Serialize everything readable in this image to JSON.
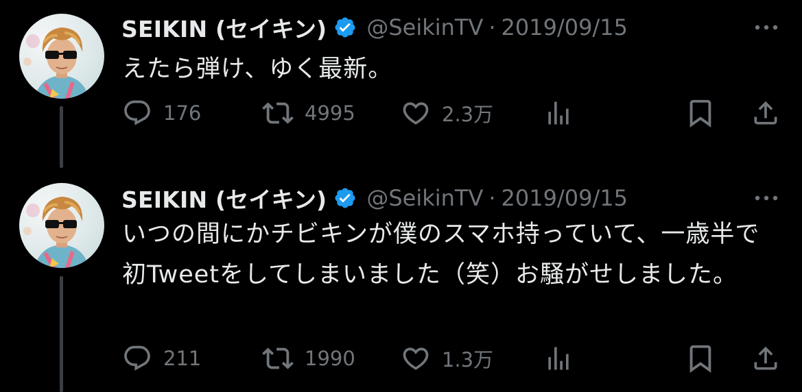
{
  "tweets": [
    {
      "author": {
        "name": "SEIKIN (セイキン)",
        "handle": "@SeikinTV",
        "verified": true
      },
      "separator": "·",
      "date": "2019/09/15",
      "text": "えたら弾け、ゆく最新。",
      "stats": {
        "replies": "176",
        "retweets": "4995",
        "likes": "2.3万"
      }
    },
    {
      "author": {
        "name": "SEIKIN (セイキン)",
        "handle": "@SeikinTV",
        "verified": true
      },
      "separator": "·",
      "date": "2019/09/15",
      "text": "いつの間にかチビキンが僕のスマホ持っていて、一歳半で初Tweetをしてしまいました（笑）お騒がせしました。",
      "stats": {
        "replies": "211",
        "retweets": "1990",
        "likes": "1.3万"
      }
    }
  ],
  "icons": {
    "reply": "speech-bubble-icon",
    "retweet": "retweet-arrows-icon",
    "like": "heart-icon",
    "views": "bar-chart-icon",
    "bookmark": "bookmark-icon",
    "share": "share-upload-icon",
    "more": "more-dots-icon",
    "verified": "verified-badge-icon"
  },
  "colors": {
    "background": "#000000",
    "text_primary": "#e7e9ea",
    "text_secondary": "#71767b",
    "verified_blue": "#1d9bf0",
    "thread_line": "#3b3f43"
  }
}
